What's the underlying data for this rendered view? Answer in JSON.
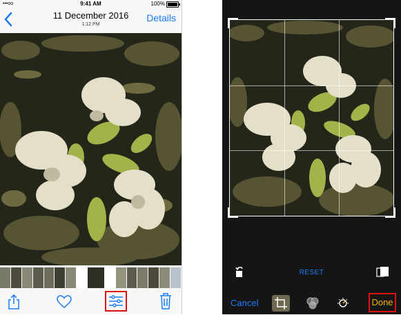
{
  "left_screen": {
    "status_bar": {
      "signal": "•••oo",
      "time": "9:41 AM",
      "battery_percent": "100%"
    },
    "nav": {
      "date": "11 December 2016",
      "time": "1:12 PM",
      "details_label": "Details"
    },
    "toolbar": {
      "share_icon": "share-icon",
      "favorite_icon": "heart-icon",
      "edit_icon": "adjust-sliders-icon",
      "delete_icon": "trash-icon"
    }
  },
  "right_screen": {
    "reset_label": "RESET",
    "cancel_label": "Cancel",
    "done_label": "Done",
    "tools": [
      "crop-rotate-icon",
      "filters-icon",
      "light-adjust-icon"
    ]
  },
  "colors": {
    "accent_blue": "#1a7cf5",
    "done_yellow": "#f5b400",
    "highlight_red": "#e01010"
  }
}
